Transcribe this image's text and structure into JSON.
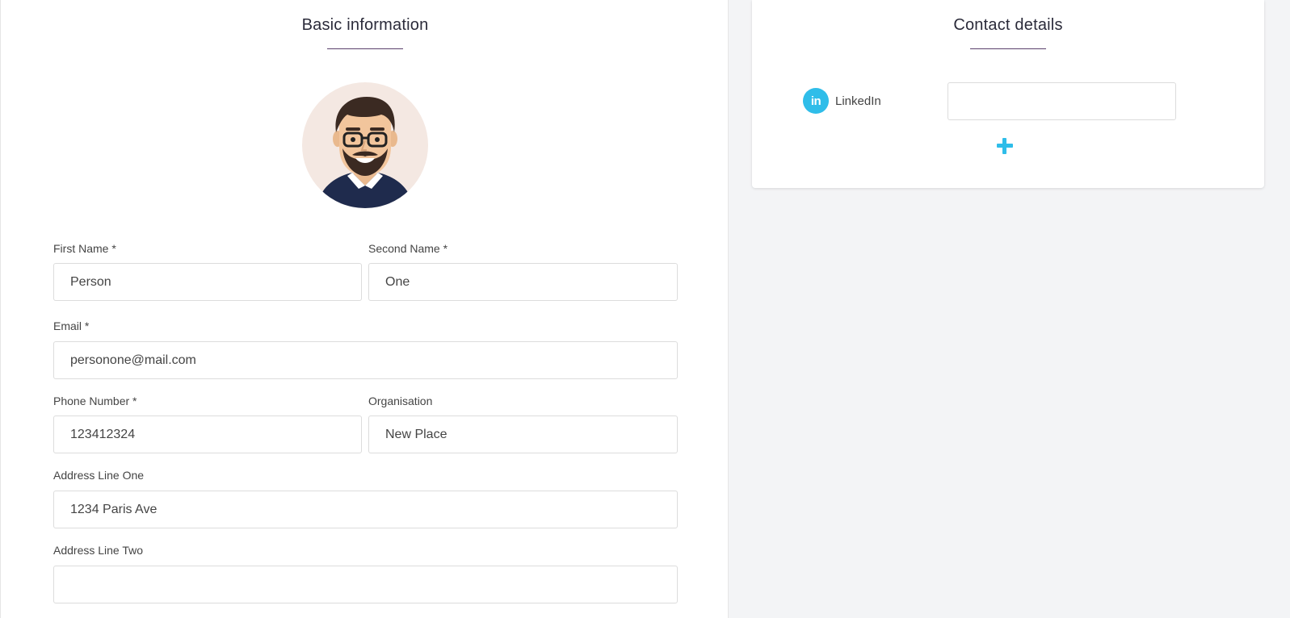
{
  "basic_info": {
    "title": "Basic information",
    "avatar_icon": "avatar-man-glasses",
    "fields": {
      "first_name": {
        "label": "First Name *",
        "value": "Person"
      },
      "second_name": {
        "label": "Second Name *",
        "value": "One"
      },
      "email": {
        "label": "Email *",
        "value": "personone@mail.com"
      },
      "phone": {
        "label": "Phone Number *",
        "value": "123412324"
      },
      "organisation": {
        "label": "Organisation",
        "value": "New Place"
      },
      "address_one": {
        "label": "Address Line One",
        "value": "1234 Paris Ave"
      },
      "address_two": {
        "label": "Address Line Two",
        "value": ""
      }
    }
  },
  "contact_details": {
    "title": "Contact details",
    "socials": [
      {
        "icon": "linkedin-icon",
        "icon_text": "in",
        "label": "LinkedIn",
        "value": ""
      }
    ],
    "add_icon": "plus-icon"
  },
  "colors": {
    "accent": "#2fbde9",
    "underline": "#5a3f6b",
    "background": "#f3f4f6"
  }
}
